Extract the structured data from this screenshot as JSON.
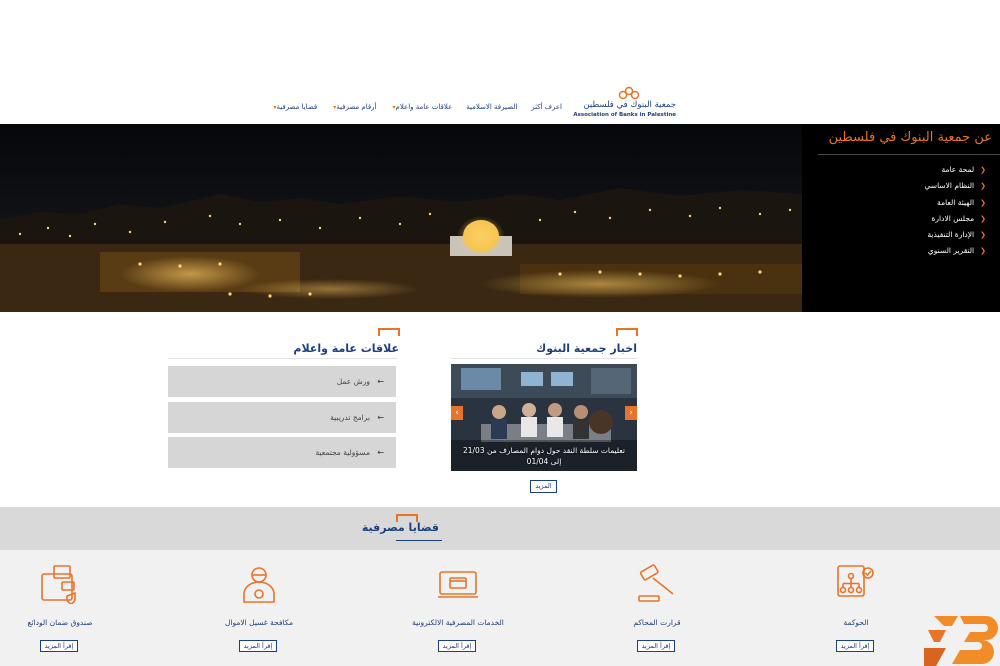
{
  "header": {
    "logo_arabic": "جمعية البنوك في فلسطين",
    "logo_english": "Association of Banks in Palestine",
    "nav": [
      {
        "label": "قضايا مصرفية",
        "dropdown": true
      },
      {
        "label": "أرقام مصرفية",
        "dropdown": true
      },
      {
        "label": "علاقات عامة واعلام",
        "dropdown": true
      },
      {
        "label": "الصيرفة الاسلامية",
        "dropdown": false
      },
      {
        "label": "اعرف أكثر",
        "dropdown": false
      }
    ]
  },
  "about": {
    "title": "عن جمعية البنوك في فلسطين",
    "items": [
      "لمحة عامة",
      "النظام الاساسي",
      "الهيئة العامة",
      "مجلس الادارة",
      "الإدارة التنفيذية",
      "التقرير السنوي"
    ]
  },
  "news": {
    "title": "اخبار جمعية البنوك",
    "caption": "تعليمات سلطة النقد حول دوام المصارف من 21/03 إلى 01/04",
    "more": "المزيد"
  },
  "pr": {
    "title": "علاقات عامة واعلام",
    "items": [
      "ورش عمل",
      "برامج تدريبية",
      "مسؤولية مجتمعية"
    ]
  },
  "issues": {
    "title": "قضايا مصرفية",
    "read_more": "إقرأ المزيد",
    "items": [
      {
        "label": "الحوكمة",
        "icon": "governance-icon"
      },
      {
        "label": "قرارت المحاكم",
        "icon": "gavel-icon"
      },
      {
        "label": "الخدمات المصرفية الالكترونية",
        "icon": "e-banking-icon"
      },
      {
        "label": "مكافحة غسيل الاموال",
        "icon": "anti-money-laundering-icon"
      },
      {
        "label": "صندوق ضمان الودائع",
        "icon": "deposit-insurance-icon"
      }
    ]
  },
  "colors": {
    "accent": "#e8742a",
    "brand": "#1d3f7a"
  }
}
